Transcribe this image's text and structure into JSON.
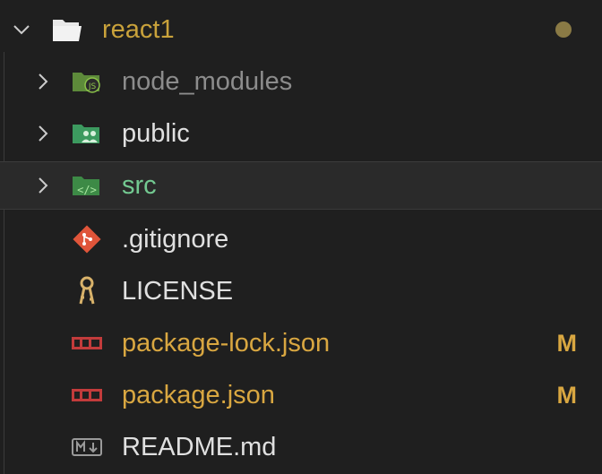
{
  "root": {
    "label": "react1",
    "expanded": true,
    "has_changes_dot": true
  },
  "items": [
    {
      "label": "node_modules",
      "type": "folder",
      "icon": "node-folder-icon",
      "status": "ignored"
    },
    {
      "label": "public",
      "type": "folder",
      "icon": "public-folder-icon",
      "status": ""
    },
    {
      "label": "src",
      "type": "folder",
      "icon": "src-folder-icon",
      "status": "untracked",
      "selected": true
    },
    {
      "label": ".gitignore",
      "type": "file",
      "icon": "git-icon",
      "status": ""
    },
    {
      "label": "LICENSE",
      "type": "file",
      "icon": "license-key-icon",
      "status": ""
    },
    {
      "label": "package-lock.json",
      "type": "file",
      "icon": "npm-icon",
      "status": "modified",
      "badge": "M"
    },
    {
      "label": "package.json",
      "type": "file",
      "icon": "npm-icon",
      "status": "modified",
      "badge": "M"
    },
    {
      "label": "README.md",
      "type": "file",
      "icon": "markdown-icon",
      "status": ""
    }
  ],
  "colors": {
    "background": "#1f1f1f",
    "modified": "#d9a741",
    "untracked": "#73c991",
    "root": "#c9a23b"
  }
}
